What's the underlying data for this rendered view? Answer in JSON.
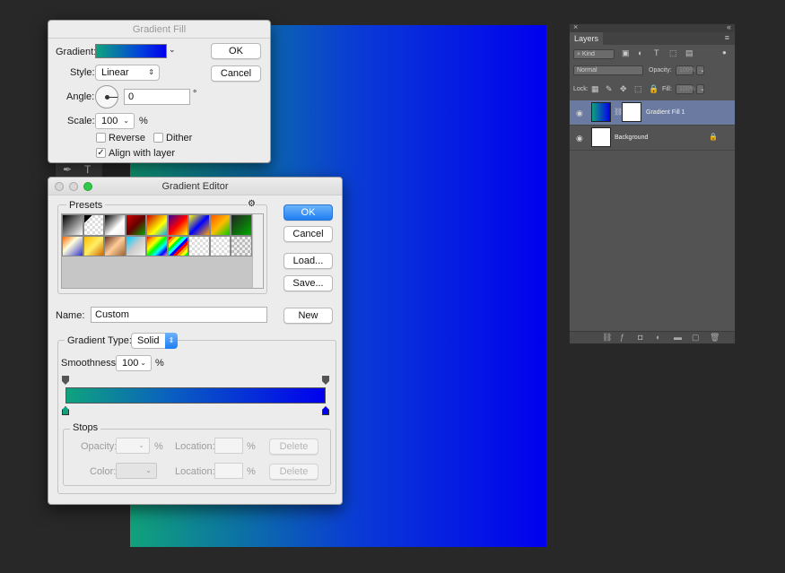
{
  "gradient_fill": {
    "title": "Gradient Fill",
    "gradient_label": "Gradient:",
    "style_label": "Style:",
    "style_value": "Linear",
    "angle_label": "Angle:",
    "angle_value": "0",
    "angle_unit": "°",
    "scale_label": "Scale:",
    "scale_value": "100",
    "scale_unit": "%",
    "reverse_label": "Reverse",
    "dither_label": "Dither",
    "align_label": "Align with layer",
    "ok_label": "OK",
    "cancel_label": "Cancel"
  },
  "gradient_editor": {
    "title": "Gradient Editor",
    "presets_label": "Presets",
    "ok_label": "OK",
    "cancel_label": "Cancel",
    "load_label": "Load...",
    "save_label": "Save...",
    "name_label": "Name:",
    "name_value": "Custom",
    "new_label": "New",
    "gradient_type_label": "Gradient Type:",
    "gradient_type_value": "Solid",
    "smoothness_label": "Smoothness:",
    "smoothness_value": "100",
    "smoothness_unit": "%",
    "stops_label": "Stops",
    "opacity_label": "Opacity:",
    "opacity_unit": "%",
    "color_label": "Color:",
    "location_label": "Location:",
    "location_unit": "%",
    "delete_label": "Delete",
    "preset_colors": [
      "linear-gradient(135deg,#000,#fff)",
      "linear-gradient(135deg,#000 0 20%,transparent 20%),repeating-conic-gradient(#ddd 0 25%,#fff 0 50%) 0 0/6px 6px",
      "linear-gradient(135deg,#000,#fff 60%,#eee)",
      "linear-gradient(135deg,#c00,#600 50%,#0a0)",
      "linear-gradient(135deg,#c00,#ff0 60%,#0af)",
      "linear-gradient(135deg,#309,#f00 50%,#ff0)",
      "linear-gradient(135deg,#ff0,#00f 50%,#fa0)",
      "linear-gradient(135deg,#f50,#fb0 50%,#0c0)",
      "linear-gradient(135deg,#222,#0a0)",
      "linear-gradient(135deg,#f60,#ffd 40%,#33c)",
      "linear-gradient(135deg,#fb0,#fe6 50%,#c60)",
      "linear-gradient(135deg,#632,#fc9 50%,#963)",
      "linear-gradient(135deg,#0cf,#ccc 50%,#eee)",
      "linear-gradient(135deg,red,orange,yellow,lime,cyan,blue,violet)",
      "repeating-linear-gradient(135deg,red 0 3px,orange 3px 6px,yellow 6px 9px,lime 9px 12px,cyan 12px 15px,blue 15px 18px)",
      "repeating-conic-gradient(#ddd 0 25%,#fff 0 50%) 0 0/6px 6px",
      "repeating-conic-gradient(#ddd 0 25%,#fff 0 50%) 0 0/6px 6px",
      "repeating-conic-gradient(#bbb 0 25%,#eee 0 50%) 0 0/6px 6px"
    ]
  },
  "layers": {
    "tab_label": "Layers",
    "kind_label": "Kind",
    "blend_value": "Normal",
    "opacity_label": "Opacity:",
    "opacity_value": "100%",
    "lock_label": "Lock:",
    "fill_label": "Fill:",
    "fill_value": "100%",
    "items": [
      {
        "name": "Gradient Fill 1",
        "selected": true
      },
      {
        "name": "Background",
        "selected": false
      }
    ]
  },
  "colors": {
    "accent_blue": "#1f7ef2",
    "gradient_start": "#0fa37d",
    "gradient_end": "#0000ee"
  }
}
